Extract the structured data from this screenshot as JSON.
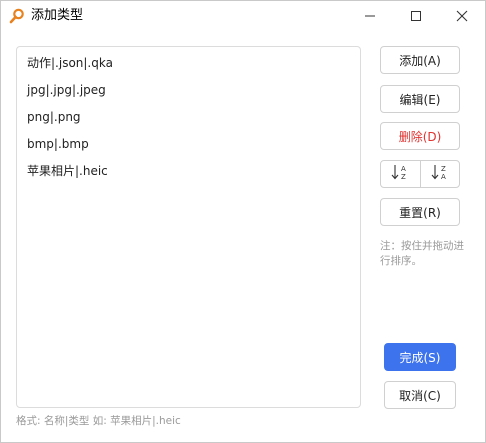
{
  "window": {
    "title": "添加类型",
    "app_icon": "magnifier-icon",
    "controls": {
      "minimize_icon": "minimize-icon",
      "maximize_icon": "maximize-icon",
      "close_icon": "close-icon"
    }
  },
  "list": {
    "items": [
      "动作|.json|.qka",
      "jpg|.jpg|.jpeg",
      "png|.png",
      "bmp|.bmp",
      "苹果相片|.heic"
    ]
  },
  "buttons": {
    "add": "添加(A)",
    "edit": "编辑(E)",
    "delete": "删除(D)",
    "reset": "重置(R)",
    "done": "完成(S)",
    "cancel": "取消(C)"
  },
  "sort": {
    "asc_icon": "sort-ascending-icon",
    "desc_icon": "sort-descending-icon"
  },
  "note": "注：按住并拖动进行排序。",
  "format_hint": "格式: 名称|类型 如: 苹果相片|.heic",
  "colors": {
    "primary": "#3e73ee",
    "danger": "#e0322f",
    "hint": "#9a9a9a",
    "icon_orange": "#e8821e"
  }
}
